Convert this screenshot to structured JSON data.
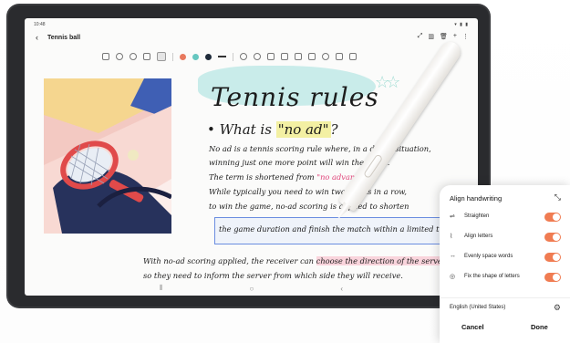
{
  "status": {
    "time": "10:48",
    "icons": "▾ ▮ ▮"
  },
  "appbar": {
    "back": "‹",
    "title": "Tennis ball",
    "icons": [
      "⤢",
      "▥",
      "🗑",
      "+",
      "⋮"
    ]
  },
  "toolbar": {
    "colors": [
      "#e8795e",
      "#66c7c0",
      "#1f2b3a"
    ]
  },
  "note": {
    "title": "Tennis rules",
    "stars": "☆☆",
    "question_prefix": "• What is ",
    "question_highlight": "\"no ad\"",
    "question_suffix": "?",
    "line1": "No ad is a tennis scoring rule where, in a deuce situation,",
    "line2": "winning just one more point will win the game.",
    "line3_a": "The term is shortened from ",
    "line3_b": "\"no advantage.\"",
    "line4": "While typically you need to win two points in a row,",
    "line5": "to win the game, no-ad scoring is applied to shorten",
    "line6": "the game duration and finish the match within a limited time.",
    "line7_a": "With no-ad scoring applied, the receiver can ",
    "line7_b": "choose the direction of the serve,",
    "line8": "so they need to inform the server from which side they will receive."
  },
  "navbar": {
    "recents": "⦀",
    "home": "○",
    "back": "‹"
  },
  "panel": {
    "title": "Align handwriting",
    "collapse_icon": "⤡",
    "options": [
      {
        "icon": "⇌",
        "label": "Straighten",
        "enabled": true
      },
      {
        "icon": "⌇",
        "label": "Align letters",
        "enabled": true
      },
      {
        "icon": "↔",
        "label": "Evenly space words",
        "enabled": true
      },
      {
        "icon": "◎",
        "label": "Fix the shape of letters",
        "enabled": true
      }
    ],
    "language": "English (United States)",
    "gear": "⚙",
    "cancel": "Cancel",
    "done": "Done"
  }
}
